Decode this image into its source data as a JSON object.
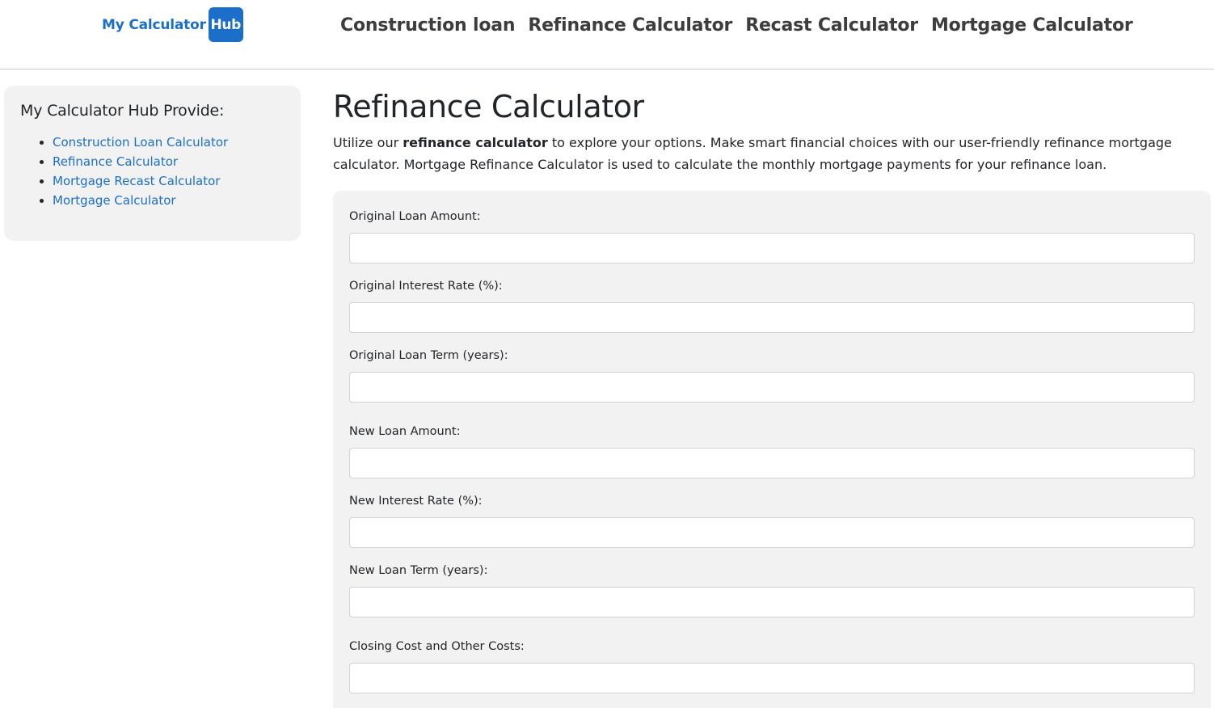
{
  "header": {
    "logo_text": "My Calculator",
    "logo_badge": "Hub",
    "nav": [
      {
        "label": "Construction loan"
      },
      {
        "label": "Refinance Calculator"
      },
      {
        "label": "Recast Calculator"
      },
      {
        "label": "Mortgage Calculator"
      }
    ]
  },
  "sidebar": {
    "title": "My Calculator Hub Provide:",
    "links": [
      {
        "label": "Construction Loan Calculator"
      },
      {
        "label": "Refinance Calculator"
      },
      {
        "label": "Mortgage Recast Calculator"
      },
      {
        "label": "Mortgage Calculator"
      }
    ]
  },
  "main": {
    "title": "Refinance Calculator",
    "intro_pre": "Utilize our ",
    "intro_bold": "refinance calculator",
    "intro_post": " to explore your options. Make smart financial choices with our user-friendly refinance mortgage calculator. Mortgage Refinance Calculator is used to calculate the monthly mortgage payments for your refinance loan.",
    "fields": [
      {
        "label": "Original Loan Amount:",
        "value": ""
      },
      {
        "label": "Original Interest Rate (%):",
        "value": ""
      },
      {
        "label": "Original Loan Term (years):",
        "value": ""
      },
      {
        "label": "New Loan Amount:",
        "value": ""
      },
      {
        "label": "New Interest Rate (%):",
        "value": ""
      },
      {
        "label": "New Loan Term (years):",
        "value": ""
      },
      {
        "label": "Closing Cost and Other Costs:",
        "value": ""
      }
    ]
  }
}
